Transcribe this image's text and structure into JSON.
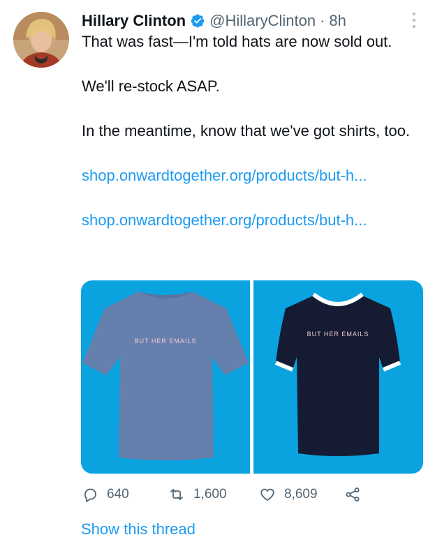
{
  "tweet": {
    "author_name": "Hillary Clinton",
    "handle": "@HillaryClinton",
    "separator": "·",
    "time": "8h",
    "text_line1": "That was fast—I'm told hats are now sold out.",
    "text_line2": "We'll re-stock ASAP.",
    "text_line3": "In the meantime, know that we've got shirts, too.",
    "link1": "shop.onwardtogether.org/products/but-h...",
    "link2": "shop.onwardtogether.org/products/but-h...",
    "shirt_print_1": "BUT HER EMAILS",
    "shirt_print_2": "BUT HER EMAILS"
  },
  "actions": {
    "replies": "640",
    "retweets": "1,600",
    "likes": "8,609"
  },
  "show_thread": "Show this thread",
  "icons": [
    "verified-badge-icon",
    "more-options-icon",
    "reply-icon",
    "retweet-icon",
    "like-icon",
    "share-icon"
  ],
  "colors": {
    "accent": "#1d9bf0",
    "text": "#0f1419",
    "muted": "#536471",
    "media_bg": "#0aa3df",
    "shirt_blue": "#6680ad",
    "shirt_navy": "#141b33"
  }
}
